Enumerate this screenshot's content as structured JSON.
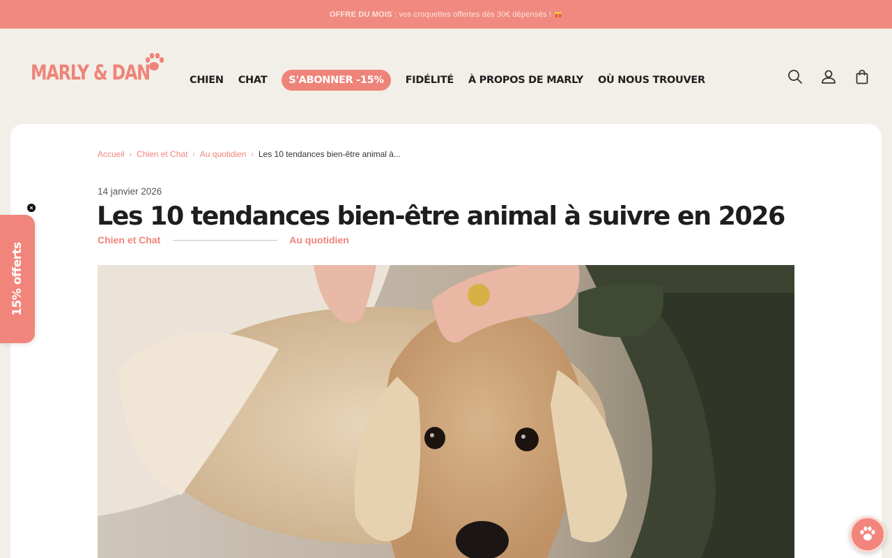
{
  "announcement": {
    "bold": "OFFRE DU MOIS",
    "text": " : vos croquettes offertes dès 30€ dépensés !",
    "icon": "gift-icon"
  },
  "logo": {
    "text": "MARLY & DAN",
    "icon": "paw-icon"
  },
  "nav": {
    "items": [
      "CHIEN",
      "CHAT",
      "S'ABONNER -15%",
      "FIDÉLITÉ",
      "À PROPOS DE MARLY",
      "OÙ NOUS TROUVER"
    ],
    "highlight_color": "#ee8479"
  },
  "header_icons": [
    "search-icon",
    "account-icon",
    "cart-icon"
  ],
  "breadcrumb": {
    "links": [
      "Accueil",
      "Chien et Chat",
      "Au quotidien"
    ],
    "separator": "›",
    "current": "Les 10 tendances bien-être animal à..."
  },
  "article": {
    "date": "14 janvier 2026",
    "title": "Les 10 tendances bien-être animal à suivre en 2026",
    "categories": [
      "Chien et Chat",
      "Au quotidien"
    ]
  },
  "side_tab": {
    "label": "15% offerts",
    "close": "×"
  },
  "chat_button": {
    "icon": "paw-chat-icon"
  },
  "colors": {
    "accent": "#ee8479",
    "background": "#f2efe8",
    "card": "#ffffff"
  }
}
